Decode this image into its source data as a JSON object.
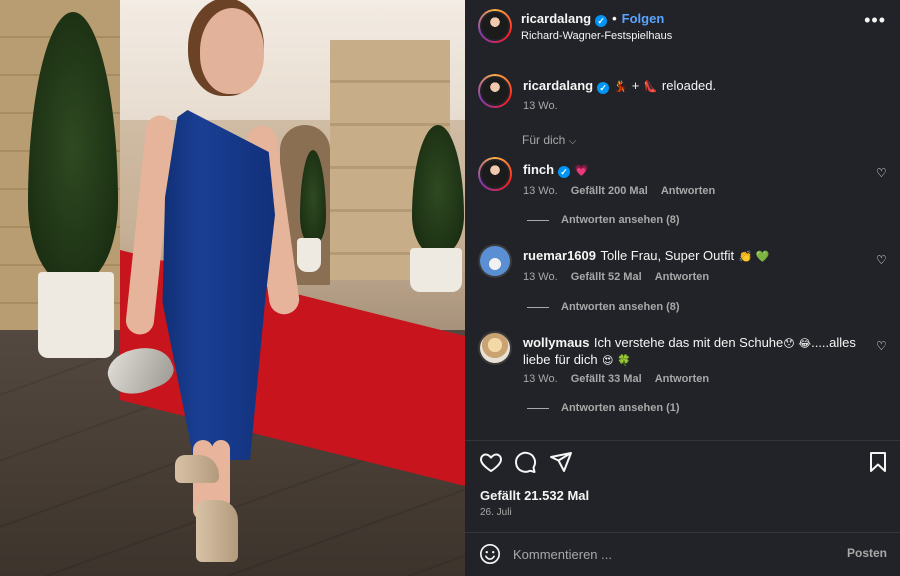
{
  "post": {
    "author": "ricardalang",
    "follow_label": "Folgen",
    "location": "Richard-Wagner-Festspielhaus",
    "more_icon": "more-options-icon",
    "caption": {
      "username": "ricardalang",
      "emoji_1": "💃",
      "plus": "+",
      "emoji_2": "👠",
      "text": "reloaded.",
      "age": "13 Wo."
    },
    "for_you_label": "Für dich",
    "likes_text": "Gefällt 21.532 Mal",
    "date": "26. Juli",
    "comment_placeholder": "Kommentieren ...",
    "post_button": "Posten"
  },
  "comments": [
    {
      "username": "finch",
      "text": "",
      "emoji": "💗",
      "age": "13 Wo.",
      "likes": "Gefällt 200 Mal",
      "reply": "Antworten",
      "view_replies": "Antworten ansehen (8)"
    },
    {
      "username": "ruemar1609",
      "text": "Tolle Frau, Super Outfit",
      "emoji": "👏 💚",
      "age": "13 Wo.",
      "likes": "Gefällt 52 Mal",
      "reply": "Antworten",
      "view_replies": "Antworten ansehen (8)"
    },
    {
      "username": "wollymaus",
      "text": "Ich verstehe das mit den Schuhe",
      "emoji_a": "😯 😂",
      "text2": ".....alles liebe",
      "text3": "für dich",
      "emoji_b": "😍 🍀",
      "age": "13 Wo.",
      "likes": "Gefällt 33 Mal",
      "reply": "Antworten",
      "view_replies": "Antworten ansehen (1)"
    }
  ],
  "colors": {
    "panel_bg": "#212328",
    "text": "#f5f5f5",
    "muted": "#a8a8a8",
    "follow": "#5aa4ff",
    "verified": "#0095f6"
  }
}
